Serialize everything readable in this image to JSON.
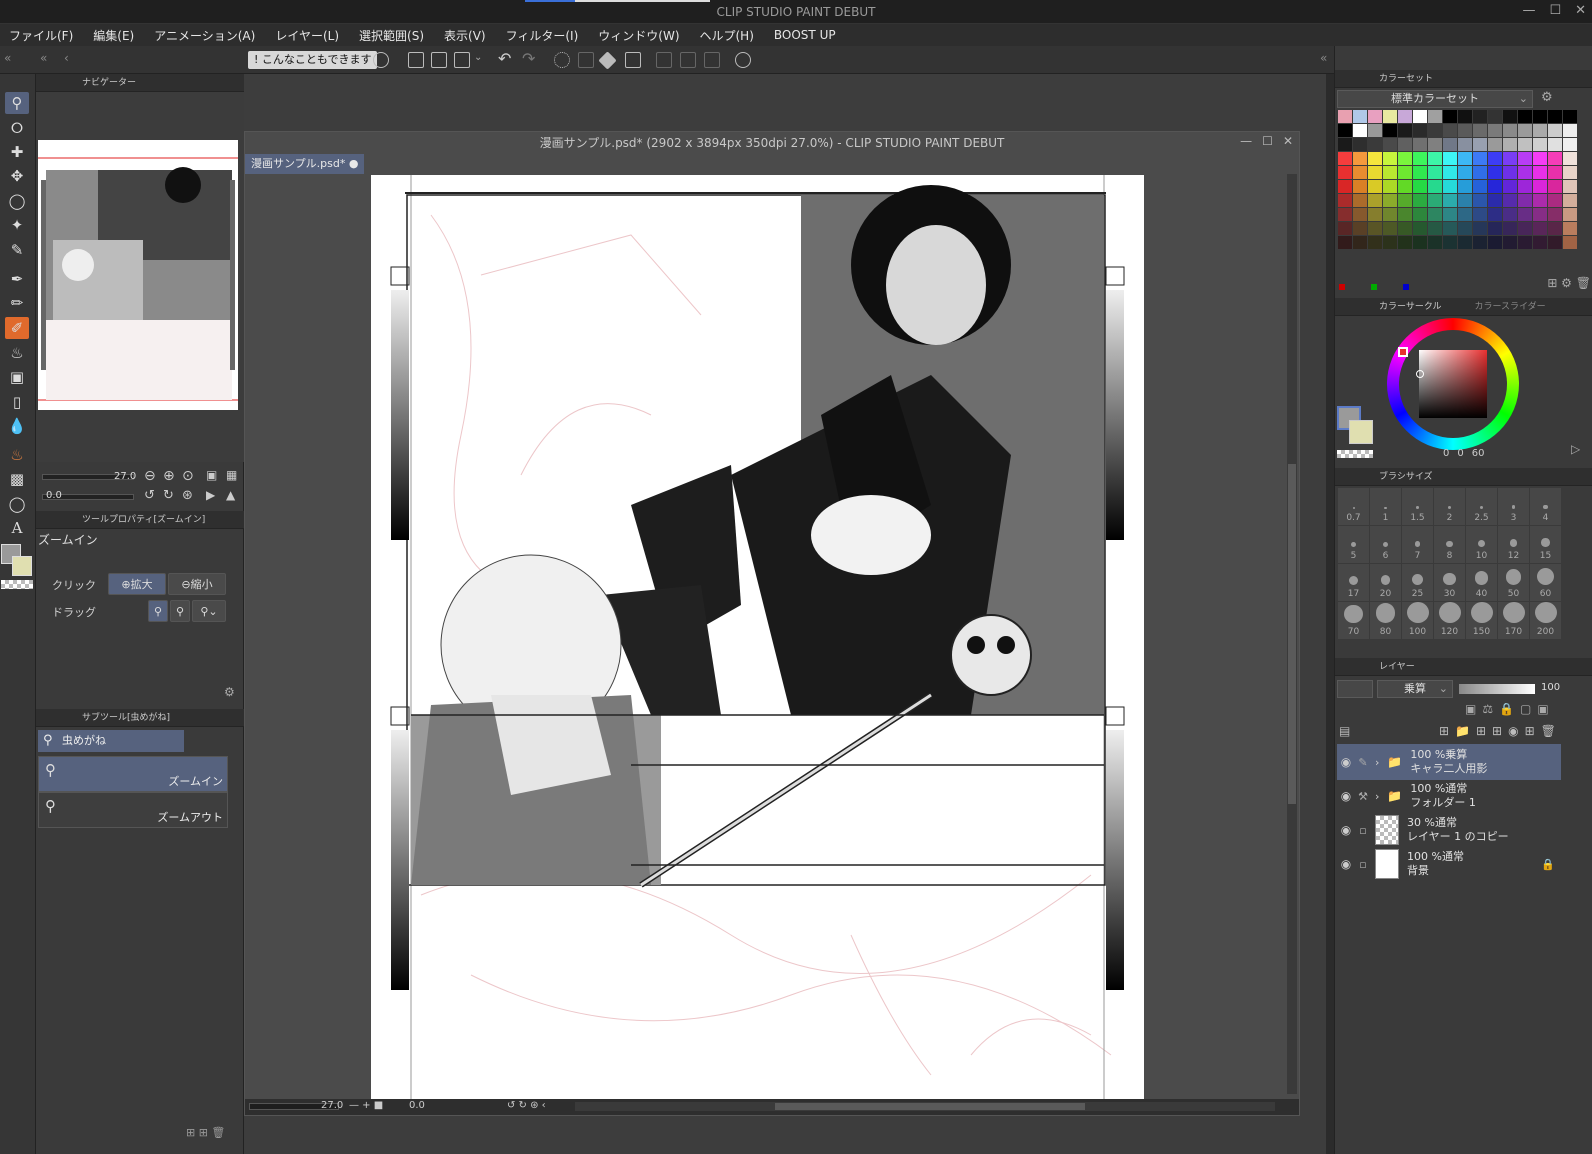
{
  "app": {
    "title": "CLIP STUDIO PAINT DEBUT"
  },
  "menu": [
    "ファイル(F)",
    "編集(E)",
    "アニメーション(A)",
    "レイヤー(L)",
    "選択範囲(S)",
    "表示(V)",
    "フィルター(I)",
    "ウィンドウ(W)",
    "ヘルプ(H)",
    "BOOST UP"
  ],
  "command_bar": {
    "tip_label": "こんなこともできます"
  },
  "navigator": {
    "panel_title": "ナビゲーター",
    "zoom_value": "27.0",
    "rotate_value": "0.0"
  },
  "tool_property": {
    "panel_title": "ツールプロパティ[ズームイン]",
    "tool_name": "ズームイン",
    "click_label": "クリック",
    "drag_label": "ドラッグ",
    "zoom_in_option": "拡大",
    "zoom_out_option": "縮小"
  },
  "sub_tool": {
    "panel_title": "サブツール[虫めがね]",
    "group_name": "虫めがね",
    "items": [
      {
        "label": "ズームイン"
      },
      {
        "label": "ズームアウト"
      }
    ]
  },
  "document": {
    "title": "漫画サンプル.psd* (2902 x 3894px 350dpi 27.0%)  - CLIP STUDIO PAINT DEBUT",
    "tab_label": "漫画サンプル.psd*",
    "status_zoom": "27.0",
    "status_rotate": "0.0"
  },
  "color_set": {
    "panel_title": "カラーセット",
    "selected_set": "標準カラーセット"
  },
  "color_circle": {
    "panel_title": "カラーサークル",
    "tab2_title": "カラースライダー",
    "h_value": "0",
    "s_value": "0",
    "v_value": "60",
    "accent_color": "#e83030"
  },
  "brush_size": {
    "panel_title": "ブラシサイズ",
    "sizes": [
      "0.7",
      "1",
      "1.5",
      "2",
      "2.5",
      "3",
      "4",
      "5",
      "6",
      "7",
      "8",
      "10",
      "12",
      "15",
      "17",
      "20",
      "25",
      "30",
      "40",
      "50",
      "60",
      "70",
      "80",
      "100",
      "120",
      "150",
      "170",
      "200"
    ]
  },
  "layers": {
    "panel_title": "レイヤー",
    "blend_mode": "乗算",
    "opacity": "100",
    "items": [
      {
        "opacity_mode": "100 %乗算",
        "name": "キャラ二人用影",
        "type": "folder",
        "selected": true
      },
      {
        "opacity_mode": "100 %通常",
        "name": "フォルダー 1",
        "type": "folder",
        "selected": false
      },
      {
        "opacity_mode": "30 %通常",
        "name": "レイヤー 1 のコピー",
        "type": "raster",
        "selected": false
      },
      {
        "opacity_mode": "100 %通常",
        "name": "背景",
        "type": "paper",
        "selected": false
      }
    ]
  },
  "colors": {
    "selection_blue": "#56627e",
    "pen_orange": "#e06a2c",
    "panel_bg": "#3a3a3a"
  }
}
